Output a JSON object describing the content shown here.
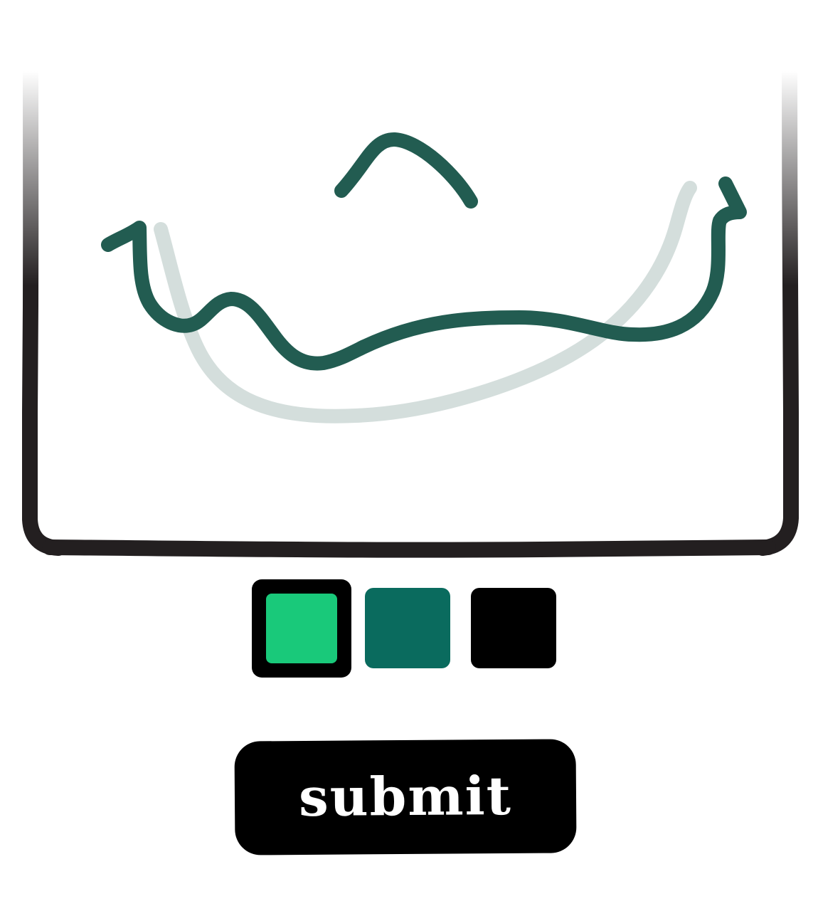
{
  "canvas": {
    "frame_color": "#231f20",
    "strokes": [
      {
        "color": "#d4dedc",
        "role": "faded-stroke"
      },
      {
        "color": "#225c51",
        "role": "eyebrow-stroke"
      },
      {
        "color": "#225c51",
        "role": "wave-stroke"
      }
    ]
  },
  "palette": {
    "selected_index": 0,
    "swatches": [
      {
        "color": "#19c97a",
        "name": "green"
      },
      {
        "color": "#0a6b5e",
        "name": "teal"
      },
      {
        "color": "#000000",
        "name": "black"
      }
    ]
  },
  "submit": {
    "label": "submit"
  }
}
